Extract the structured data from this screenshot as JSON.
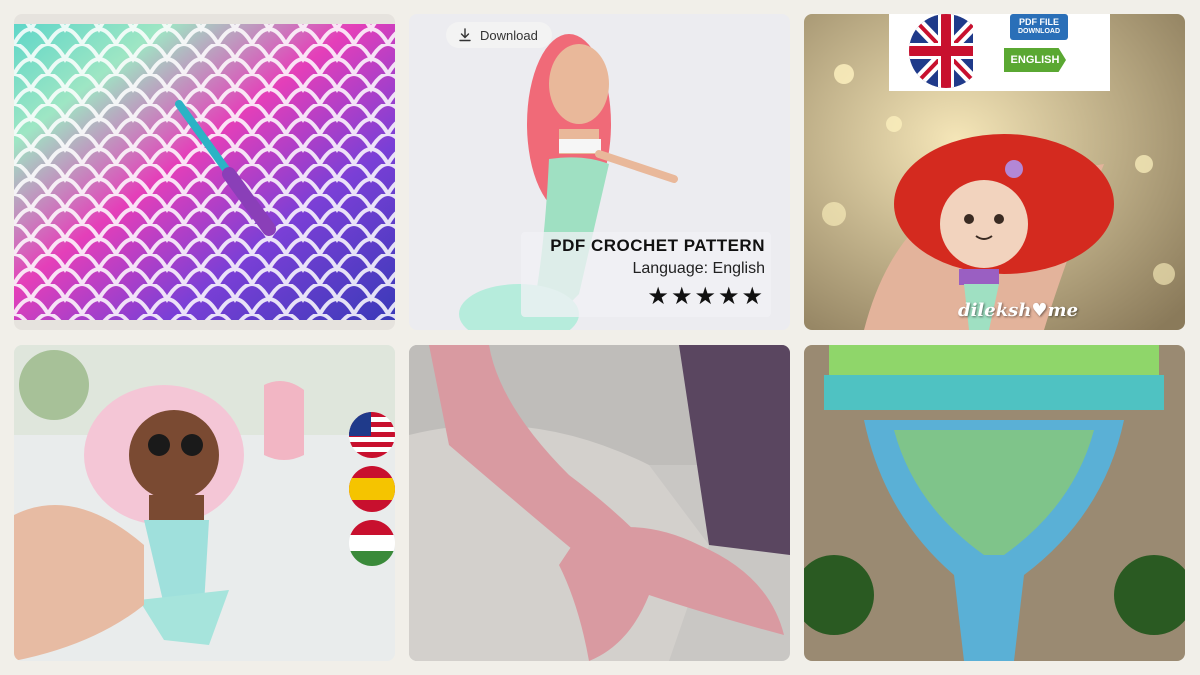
{
  "download": {
    "label": "Download",
    "icon": "download-icon"
  },
  "pdf_panel": {
    "title": "PDF CROCHET PATTERN",
    "language": "Language: English",
    "stars": "★★★★★",
    "rating": 5
  },
  "badges": {
    "english": "ENGLISH",
    "pdf_file": "PDF FILE",
    "pdf_file_sub": "DOWNLOAD"
  },
  "watermark": "dileksh♥me",
  "flags": [
    "us-flag",
    "spain-flag",
    "hungary-flag"
  ],
  "colors": {
    "background": "#f1efe9",
    "pink_tail": "#d99aa1",
    "english_green": "#5aa832"
  }
}
